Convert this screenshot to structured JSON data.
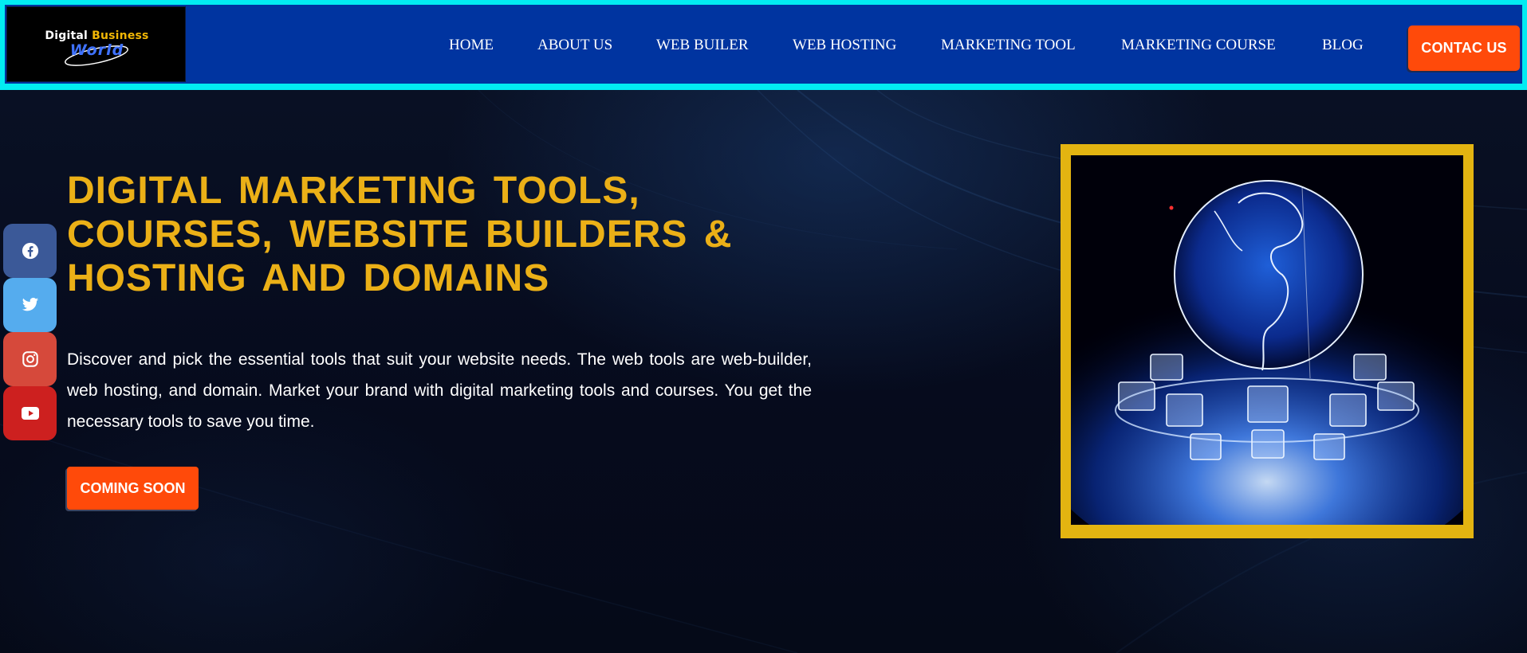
{
  "brand": {
    "logo_line1_part1": "Digital",
    "logo_line1_part2": "Business",
    "logo_line2": "World"
  },
  "nav": {
    "items": [
      {
        "label": "HOME"
      },
      {
        "label": "ABOUT US"
      },
      {
        "label": "WEB BUILER"
      },
      {
        "label": "WEB HOSTING"
      },
      {
        "label": "MARKETING TOOL"
      },
      {
        "label": "MARKETING COURSE"
      },
      {
        "label": "BLOG"
      }
    ],
    "contact_label": "CONTAC US"
  },
  "hero": {
    "title_lines": [
      "DIGITAL MARKETING TOOLS,",
      "COURSES, WEBSITE BUILDERS &",
      "HOSTING AND DOMAINS"
    ],
    "description": "Discover and pick the essential tools that suit your website needs. The web tools are web-builder, web hosting, and domain. Market your brand with digital marketing tools and courses. You get the necessary tools to save you time.",
    "cta_label": "COMING SOON"
  },
  "social": [
    {
      "icon": "facebook-icon"
    },
    {
      "icon": "twitter-icon"
    },
    {
      "icon": "instagram-icon"
    },
    {
      "icon": "youtube-icon"
    }
  ],
  "colors": {
    "header_border": "#02ecf2",
    "header_bg": "#0034a0",
    "accent_orange": "#ff4a0a",
    "title_gold": "#ebb017",
    "frame_gold": "#e3b411"
  }
}
